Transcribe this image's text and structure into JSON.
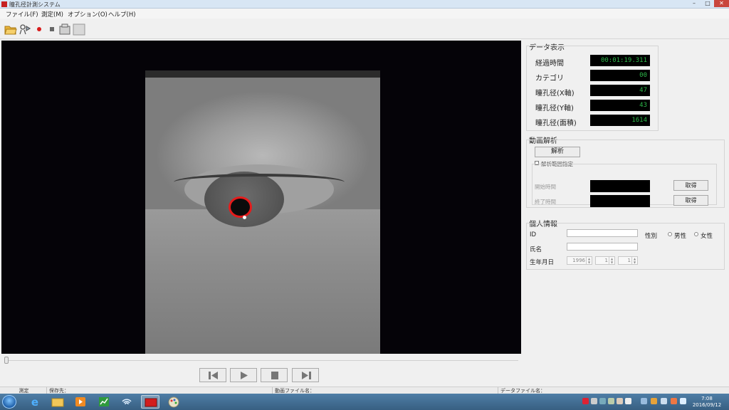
{
  "window": {
    "title": "瞳孔径計測システム",
    "minimize": "–",
    "maximize": "□",
    "close": "✕"
  },
  "menu": {
    "items": [
      "ファイル(F)",
      "測定(M)",
      "オプション(O)",
      "ヘルプ(H)"
    ]
  },
  "toolbar": {
    "icons": [
      "folder-open-icon",
      "camera-settings-icon",
      "record-icon",
      "stop-icon",
      "capture-icon",
      "grid-icon"
    ]
  },
  "data_display": {
    "title": "データ表示",
    "rows": [
      {
        "label": "経過時間",
        "value": "00:01:19.311"
      },
      {
        "label": "カテゴリ",
        "value": "00"
      },
      {
        "label": "瞳孔径(X軸)",
        "value": "47"
      },
      {
        "label": "瞳孔径(Y軸)",
        "value": "43"
      },
      {
        "label": "瞳孔径(面積)",
        "value": "1614"
      }
    ],
    "value_color": "#2db84a"
  },
  "video_analysis": {
    "title": "動画解析",
    "analyze_button": "解析",
    "range_checkbox": "解析範囲指定",
    "range_checked": false,
    "start_label": "開始時間",
    "end_label": "終了時間",
    "get_button": "取得"
  },
  "personal": {
    "title": "個人情報",
    "id_label": "ID",
    "gender_label": "性別",
    "male": "男性",
    "female": "女性",
    "name_label": "氏名",
    "dob_label": "生年月日",
    "year": "1996",
    "month": "1",
    "day": "1"
  },
  "status": {
    "mode": "測定",
    "save_to": "保存先：",
    "video_file": "動画ファイル名：",
    "data_file": "データファイル名："
  },
  "clock": {
    "time": "7:08",
    "date": "2016/09/12"
  },
  "colors": {
    "pupil_marker": "#e51b1b",
    "taskbar": "#4a78a0"
  }
}
